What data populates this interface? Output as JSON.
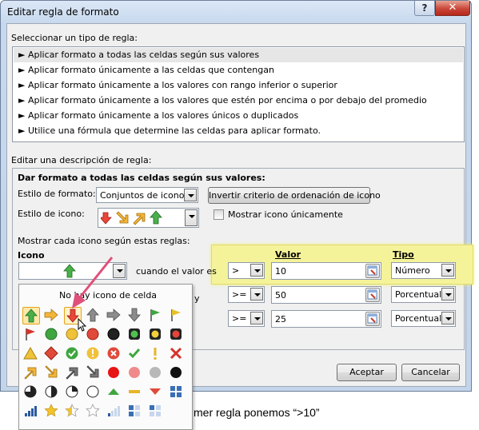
{
  "window": {
    "title": "Editar regla de formato",
    "help_glyph": "?",
    "close_glyph": "✕"
  },
  "rule_type": {
    "label": "Seleccionar un tipo de regla:",
    "items": [
      "► Aplicar formato a todas las celdas según sus valores",
      "► Aplicar formato únicamente a las celdas que contengan",
      "► Aplicar formato únicamente a los valores con rango inferior o superior",
      "► Aplicar formato únicamente a los valores que estén por encima o por debajo del promedio",
      "► Aplicar formato únicamente a los valores únicos o duplicados",
      "► Utilice una fórmula que determine las celdas para aplicar formato."
    ],
    "selected_index": 0
  },
  "description": {
    "label": "Editar una descripción de regla:",
    "heading": "Dar formato a todas las celdas según sus valores:",
    "format_style_label": "Estilo de formato:",
    "format_style_value": "Conjuntos de iconos",
    "reverse_button": "Invertir criterio de ordenación de icono",
    "icon_style_label": "Estilo de icono:",
    "show_icon_only_label": "Mostrar icono únicamente",
    "show_icon_only_checked": false,
    "rules_label": "Mostrar cada icono según estas reglas:",
    "col_icon": "Icono",
    "col_value": "Valor",
    "col_type": "Tipo",
    "when_value_is": "cuando el valor es",
    "and_text": "y",
    "rows": [
      {
        "operator": ">",
        "value": "10",
        "type": "Número"
      },
      {
        "operator": ">=",
        "value": "50",
        "type": "Porcentual"
      },
      {
        "operator": ">=",
        "value": "25",
        "type": "Porcentual"
      }
    ]
  },
  "icon_picker": {
    "no_icon_label": "No hay icono de celda",
    "icon_names": [
      "green-up-arrow",
      "yellow-right-arrow",
      "red-down-arrow",
      "gray-up-arrow",
      "gray-right-arrow",
      "gray-down-arrow",
      "green-flag",
      "yellow-flag",
      "red-flag",
      "green-circle",
      "yellow-circle",
      "red-circle",
      "black-circle",
      "green-traffic-light",
      "yellow-traffic-light",
      "red-traffic-light",
      "yellow-triangle",
      "red-diamond",
      "green-check-circle",
      "yellow-exclamation-circle",
      "red-x-circle",
      "green-check",
      "yellow-exclamation",
      "red-x",
      "yellow-up-right-arrow",
      "yellow-down-right-arrow",
      "gray-up-right-arrow",
      "gray-down-right-arrow",
      "red-circle-solid",
      "pink-circle",
      "gray-circle",
      "black-circle-solid",
      "quarter-circle-3",
      "quarter-circle-2",
      "quarter-circle-1",
      "empty-circle",
      "green-triangle-up",
      "yellow-dash",
      "red-triangle-down",
      "blue-boxes-4",
      "signal-bars-4",
      "gold-star",
      "half-star",
      "empty-star",
      "signal-bars-1",
      "blue-boxes-2",
      "blue-boxes-1"
    ]
  },
  "footer": {
    "ok": "Aceptar",
    "cancel": "Cancelar"
  },
  "caption": "mer regla ponemos “>10”",
  "colors": {
    "window_frame": "#c3d5eb",
    "close_red": "#c9473a",
    "highlight_yellow": "#f5f39a",
    "annotation_arrow": "#e0507a"
  }
}
